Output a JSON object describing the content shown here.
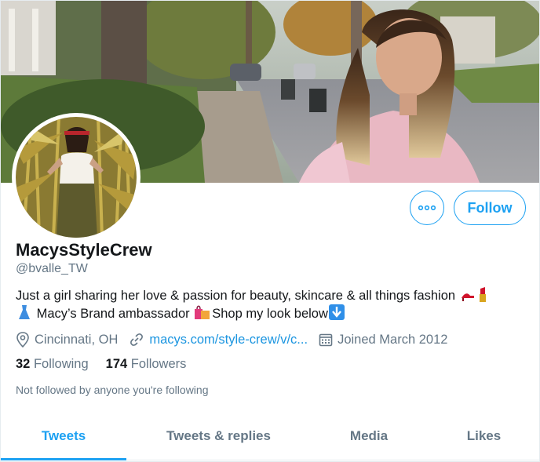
{
  "profile": {
    "display_name": "MacysStyleCrew",
    "handle": "@bvalle_TW",
    "bio_line1": "Just a girl sharing her love & passion for beauty, skincare & all things fashion",
    "bio_line2a": "Macy’s Brand ambassador",
    "bio_line2b": "Shop my look below",
    "bio_emojis": [
      "high-heel-icon",
      "lipstick-icon",
      "dress-icon",
      "shopping-bags-icon",
      "down-arrow-icon"
    ],
    "location": "Cincinnati, OH",
    "website": "macys.com/style-crew/v/c...",
    "joined": "Joined March 2012"
  },
  "stats": {
    "following_count": "32",
    "following_label": "Following",
    "followers_count": "174",
    "followers_label": "Followers"
  },
  "not_followed_text": "Not followed by anyone you're following",
  "actions": {
    "follow_label": "Follow",
    "more_icon": "more-icon"
  },
  "tabs": [
    {
      "label": "Tweets",
      "active": true
    },
    {
      "label": "Tweets & replies",
      "active": false
    },
    {
      "label": "Media",
      "active": false
    },
    {
      "label": "Likes",
      "active": false
    }
  ],
  "colors": {
    "accent": "#1da1f2",
    "link": "#1b95e0",
    "secondary_text": "#657786",
    "primary_text": "#14171a"
  }
}
